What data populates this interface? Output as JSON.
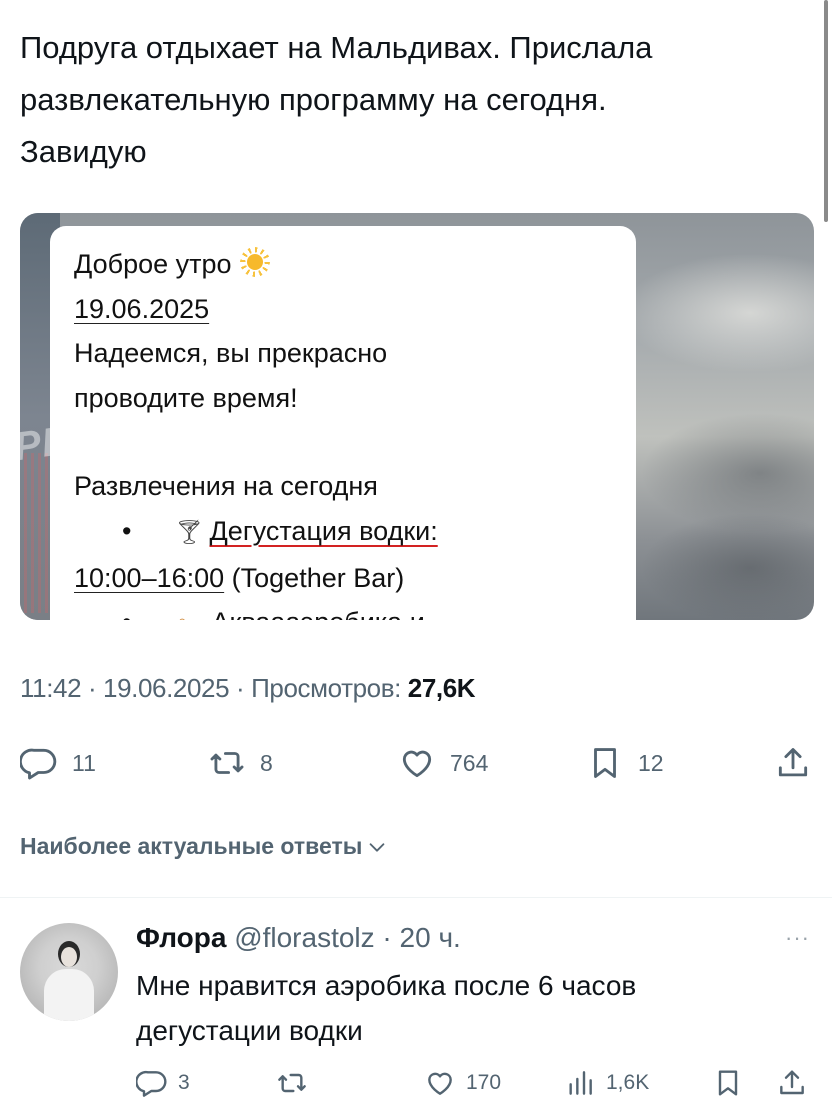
{
  "post": {
    "text_lines": [
      "Подруга отдыхает на Мальдивах. Прислала",
      "развлекательную программу на сегодня.",
      "Завидую"
    ],
    "media": {
      "watermark": "РРиБ",
      "message": {
        "greeting": "Доброе утро",
        "greeting_emoji": "sun-emoji",
        "date": "19.06.2025",
        "line1": "Надеемся, вы прекрасно",
        "line2": "проводите время!",
        "section_title": "Развлечения на сегодня",
        "bullet": "•",
        "item1_emoji": "cocktail-glass-emoji",
        "item1_title": "Дегустация водки:",
        "item1_time": "10:00–16:00",
        "item1_place": " (Together Bar)",
        "item2_emoji": "aqua-aerobics-emoji",
        "item2_title": "Акваааэробика и"
      }
    },
    "meta": {
      "time": "11:42",
      "sep": " · ",
      "date": "19.06.2025",
      "views_label": "Просмотров: ",
      "views_value": "27,6K"
    },
    "actions": {
      "replies": "11",
      "reposts": "8",
      "likes": "764",
      "bookmarks": "12"
    }
  },
  "replies_sort": {
    "label": "Наиболее актуальные ответы"
  },
  "reply": {
    "name": "Флора",
    "handle": "@florastolz",
    "sep": " · ",
    "time": "20 ч.",
    "more": "···",
    "text_lines": [
      "Мне нравится аэробика после 6 часов",
      "дегустации водки"
    ],
    "actions": {
      "replies": "3",
      "likes": "170",
      "views": "1,6K"
    }
  },
  "colors": {
    "text_primary": "#0f1419",
    "text_secondary": "#536471",
    "underline_red": "#d32222"
  }
}
